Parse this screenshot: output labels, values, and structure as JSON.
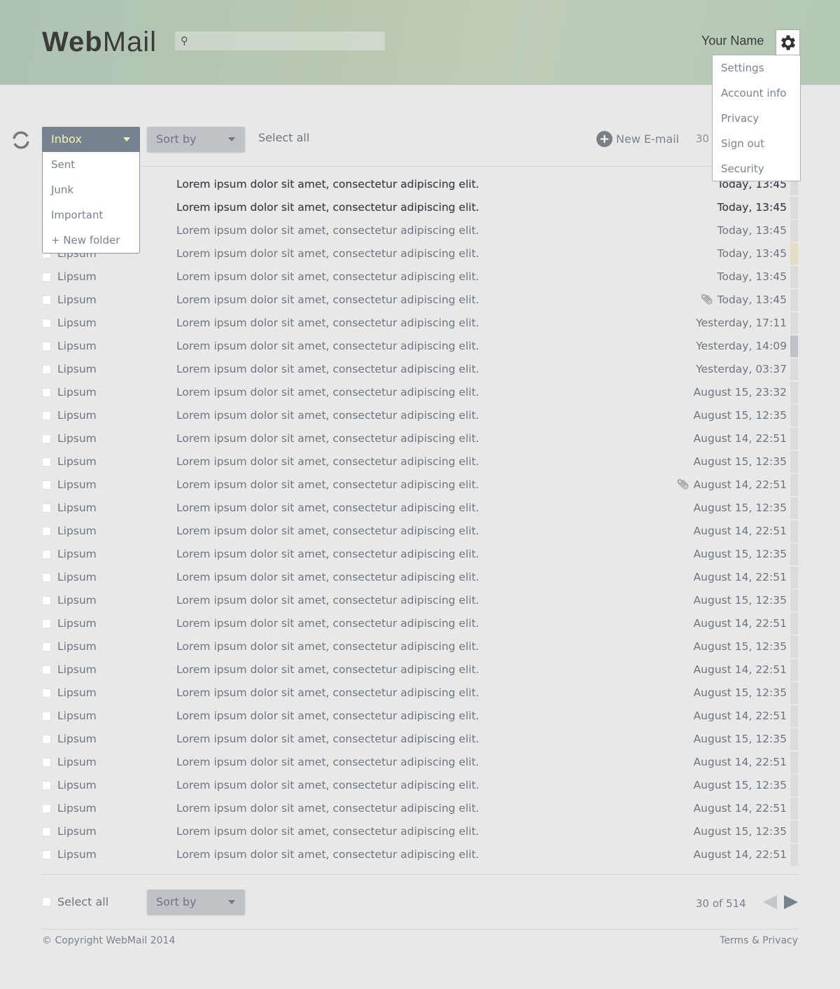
{
  "header": {
    "logo_bold": "Web",
    "logo_light": "Mail",
    "search_placeholder": "",
    "user_name": "Your Name"
  },
  "user_menu": [
    "Settings",
    "Account info",
    "Privacy",
    "Sign out",
    "Security"
  ],
  "toolbar": {
    "folder": "Inbox",
    "folders": [
      "Sent",
      "Junk",
      "Important",
      "+ New folder"
    ],
    "sort_label": "Sort by",
    "select_all": "Select all",
    "new_email": "New E-mail",
    "count": "30"
  },
  "colors": {
    "flag_default": "#d9dcda",
    "flag_yellow": "#e3dfc6",
    "flag_grey": "#bfc3c8",
    "inbox_bg": "#76838f",
    "inbox_text": "#f3f0b8"
  },
  "emails": [
    {
      "sender": "Lipsum",
      "subject": "Lorem ipsum dolor sit amet, consectetur adipiscing elit.",
      "date": "Today, 13:45",
      "unread": true
    },
    {
      "sender": "Lipsum",
      "subject": "Lorem ipsum dolor sit amet, consectetur adipiscing elit.",
      "date": "Today, 13:45",
      "unread": true
    },
    {
      "sender": "Lipsum",
      "subject": "Lorem ipsum dolor sit amet, consectetur adipiscing elit.",
      "date": "Today, 13:45"
    },
    {
      "sender": "Lipsum",
      "subject": "Lorem ipsum dolor sit amet, consectetur adipiscing elit.",
      "date": "Today, 13:45",
      "flag": "yellow"
    },
    {
      "sender": "Lipsum",
      "subject": "Lorem ipsum dolor sit amet, consectetur adipiscing elit.",
      "date": "Today, 13:45"
    },
    {
      "sender": "Lipsum",
      "subject": "Lorem ipsum dolor sit amet, consectetur adipiscing elit.",
      "date": "Today, 13:45",
      "attachment": true
    },
    {
      "sender": "Lipsum",
      "subject": "Lorem ipsum dolor sit amet, consectetur adipiscing elit.",
      "date": "Yesterday, 17:11"
    },
    {
      "sender": "Lipsum",
      "subject": "Lorem ipsum dolor sit amet, consectetur adipiscing elit.",
      "date": "Yesterday, 14:09",
      "flag": "grey"
    },
    {
      "sender": "Lipsum",
      "subject": "Lorem ipsum dolor sit amet, consectetur adipiscing elit.",
      "date": "Yesterday, 03:37"
    },
    {
      "sender": "Lipsum",
      "subject": "Lorem ipsum dolor sit amet, consectetur adipiscing elit.",
      "date": "August 15, 23:32"
    },
    {
      "sender": "Lipsum",
      "subject": "Lorem ipsum dolor sit amet, consectetur adipiscing elit.",
      "date": "August 15, 12:35"
    },
    {
      "sender": "Lipsum",
      "subject": "Lorem ipsum dolor sit amet, consectetur adipiscing elit.",
      "date": "August 14, 22:51"
    },
    {
      "sender": "Lipsum",
      "subject": "Lorem ipsum dolor sit amet, consectetur adipiscing elit.",
      "date": "August 15, 12:35"
    },
    {
      "sender": "Lipsum",
      "subject": "Lorem ipsum dolor sit amet, consectetur adipiscing elit.",
      "date": "August 14, 22:51",
      "attachment": true
    },
    {
      "sender": "Lipsum",
      "subject": "Lorem ipsum dolor sit amet, consectetur adipiscing elit.",
      "date": "August 15, 12:35"
    },
    {
      "sender": "Lipsum",
      "subject": "Lorem ipsum dolor sit amet, consectetur adipiscing elit.",
      "date": "August 14, 22:51"
    },
    {
      "sender": "Lipsum",
      "subject": "Lorem ipsum dolor sit amet, consectetur adipiscing elit.",
      "date": "August 15, 12:35"
    },
    {
      "sender": "Lipsum",
      "subject": "Lorem ipsum dolor sit amet, consectetur adipiscing elit.",
      "date": "August 14, 22:51"
    },
    {
      "sender": "Lipsum",
      "subject": "Lorem ipsum dolor sit amet, consectetur adipiscing elit.",
      "date": "August 15, 12:35"
    },
    {
      "sender": "Lipsum",
      "subject": "Lorem ipsum dolor sit amet, consectetur adipiscing elit.",
      "date": "August 14, 22:51"
    },
    {
      "sender": "Lipsum",
      "subject": "Lorem ipsum dolor sit amet, consectetur adipiscing elit.",
      "date": "August 15, 12:35"
    },
    {
      "sender": "Lipsum",
      "subject": "Lorem ipsum dolor sit amet, consectetur adipiscing elit.",
      "date": "August 14, 22:51"
    },
    {
      "sender": "Lipsum",
      "subject": "Lorem ipsum dolor sit amet, consectetur adipiscing elit.",
      "date": "August 15, 12:35"
    },
    {
      "sender": "Lipsum",
      "subject": "Lorem ipsum dolor sit amet, consectetur adipiscing elit.",
      "date": "August 14, 22:51"
    },
    {
      "sender": "Lipsum",
      "subject": "Lorem ipsum dolor sit amet, consectetur adipiscing elit.",
      "date": "August 15, 12:35"
    },
    {
      "sender": "Lipsum",
      "subject": "Lorem ipsum dolor sit amet, consectetur adipiscing elit.",
      "date": "August 14, 22:51"
    },
    {
      "sender": "Lipsum",
      "subject": "Lorem ipsum dolor sit amet, consectetur adipiscing elit.",
      "date": "August 15, 12:35"
    },
    {
      "sender": "Lipsum",
      "subject": "Lorem ipsum dolor sit amet, consectetur adipiscing elit.",
      "date": "August 14, 22:51"
    },
    {
      "sender": "Lipsum",
      "subject": "Lorem ipsum dolor sit amet, consectetur adipiscing elit.",
      "date": "August 15, 12:35"
    },
    {
      "sender": "Lipsum",
      "subject": "Lorem ipsum dolor sit amet, consectetur adipiscing elit.",
      "date": "August 14, 22:51"
    }
  ],
  "bottom": {
    "select_all": "Select all",
    "sort_label": "Sort by",
    "pager": "30 of 514"
  },
  "footer": {
    "copyright": "© Copyright WebMail 2014",
    "terms": "Terms & Privacy"
  }
}
